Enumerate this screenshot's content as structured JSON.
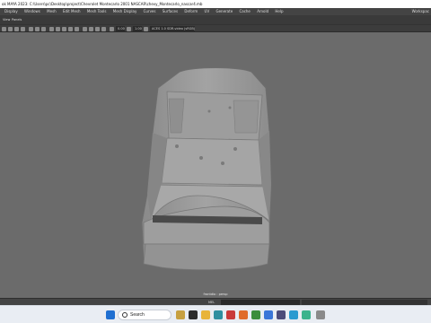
{
  "window": {
    "title": "ok MAYA 2023: C:\\Users\\pc\\Desktop\\project\\Chevrolet Montecarlo 2001 NASCAR\\chevy_Montecarlo_nascar4.mb"
  },
  "menubar": {
    "items": [
      "Display",
      "Windows",
      "Mesh",
      "Edit Mesh",
      "Mesh Tools",
      "Mesh Display",
      "Curves",
      "Surfaces",
      "Deform",
      "UV",
      "Generate",
      "Cache",
      "Arnold",
      "Help"
    ],
    "workspace": "Workspac"
  },
  "viewport_menu": [
    "View",
    "Panels"
  ],
  "toolbar": {
    "near_clip": "0.00",
    "far_clip": "1.00",
    "color_space": "ACES 1.0 SDR-video (sRGB)"
  },
  "viewport": {
    "camera_label": "frontdio : persp",
    "background_color": "#6b6b6b",
    "model_color": "#9a9a9a"
  },
  "command_line": {
    "label": "MEL"
  },
  "taskbar": {
    "search_placeholder": "Search"
  }
}
